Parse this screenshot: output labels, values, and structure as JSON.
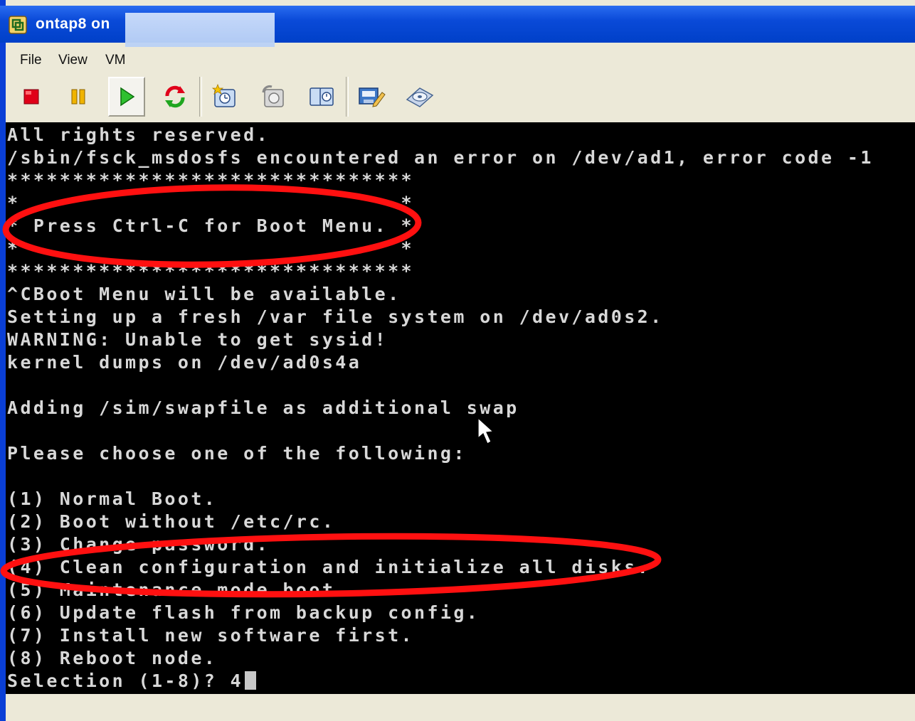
{
  "window": {
    "title": "ontap8 on",
    "accent_color": "#0a4ad8",
    "icon": "vmware-console-icon"
  },
  "menu": {
    "items": [
      {
        "label": "File"
      },
      {
        "label": "View"
      },
      {
        "label": "VM"
      }
    ]
  },
  "toolbar": {
    "buttons": [
      {
        "icon": "stop-icon",
        "pressed": false
      },
      {
        "icon": "pause-icon",
        "pressed": false
      },
      {
        "icon": "play-icon",
        "pressed": true
      },
      {
        "icon": "reset-icon",
        "pressed": false
      },
      {
        "icon": "take-snapshot-icon",
        "pressed": false
      },
      {
        "icon": "revert-snapshot-icon",
        "pressed": false
      },
      {
        "icon": "snapshot-manager-icon",
        "pressed": false
      },
      {
        "icon": "edit-settings-icon",
        "pressed": false
      },
      {
        "icon": "cd-drive-icon",
        "pressed": false
      }
    ]
  },
  "console": {
    "lines": [
      "All rights reserved.",
      "/sbin/fsck_msdosfs encountered an error on /dev/ad1, error code -1",
      "*******************************",
      "*                             *",
      "* Press Ctrl-C for Boot Menu. *",
      "*                             *",
      "*******************************",
      "^CBoot Menu will be available.",
      "Setting up a fresh /var file system on /dev/ad0s2.",
      "WARNING: Unable to get sysid!",
      "kernel dumps on /dev/ad0s4a",
      "",
      "Adding /sim/swapfile as additional swap",
      "",
      "Please choose one of the following:",
      "",
      "(1) Normal Boot.",
      "(2) Boot without /etc/rc.",
      "(3) Change password.",
      "(4) Clean configuration and initialize all disks.",
      "(5) Maintenance mode boot.",
      "(6) Update flash from backup config.",
      "(7) Install new software first.",
      "(8) Reboot node.",
      "Selection (1-8)? 4"
    ],
    "text_color": "#d8d8d8",
    "background": "#000000"
  },
  "annotations": {
    "color": "#ff0000",
    "highlighted": [
      "* Press Ctrl-C for Boot Menu. *",
      "(4) Clean configuration and initialize all disks."
    ]
  }
}
